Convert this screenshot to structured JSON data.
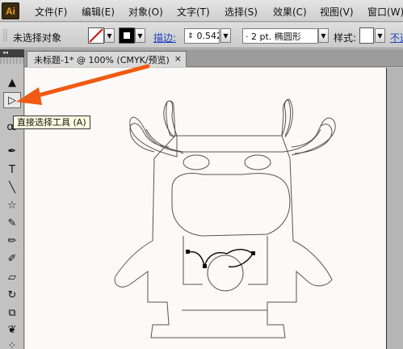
{
  "app": {
    "logo": "Ai"
  },
  "menu": {
    "items": [
      "文件(F)",
      "编辑(E)",
      "对象(O)",
      "文字(T)",
      "选择(S)",
      "效果(C)",
      "视图(V)",
      "窗口(W)"
    ]
  },
  "control_bar": {
    "selection_status": "未选择对象",
    "stroke_label": "描边:",
    "stroke_weight": "0.542",
    "brush": "·  2 pt. 椭圆形",
    "style_label": "样式:",
    "opacity_label": "不透"
  },
  "document_tab": {
    "title": "未标题-1* @ 100% (CMYK/预览)",
    "close": "×"
  },
  "tooltip": {
    "text": "直接选择工具 (A)"
  },
  "tools": [
    {
      "icon": "selection-tool-icon",
      "glyph": "▲"
    },
    {
      "icon": "direct-selection-tool-icon",
      "glyph": "▷",
      "active": true
    },
    {
      "icon": "lasso-tool-icon",
      "glyph": "ꝏ"
    },
    {
      "icon": "pen-tool-icon",
      "glyph": "✒"
    },
    {
      "icon": "type-tool-icon",
      "glyph": "T"
    },
    {
      "icon": "line-tool-icon",
      "glyph": "╲"
    },
    {
      "icon": "star-tool-icon",
      "glyph": "☆"
    },
    {
      "icon": "paintbrush-tool-icon",
      "glyph": "✎"
    },
    {
      "icon": "pencil-tool-icon",
      "glyph": "✏"
    },
    {
      "icon": "blob-brush-tool-icon",
      "glyph": "✐"
    },
    {
      "icon": "eraser-tool-icon",
      "glyph": "▱"
    },
    {
      "icon": "rotate-tool-icon",
      "glyph": "↻"
    },
    {
      "icon": "scale-tool-icon",
      "glyph": "⧉"
    },
    {
      "icon": "warp-tool-icon",
      "glyph": "❦"
    },
    {
      "icon": "symbol-sprayer-tool-icon",
      "glyph": "⁘"
    }
  ],
  "colors": {
    "annotation_arrow": "#f05a12",
    "artboard": "#fdf9f8",
    "ui_gray": "#c9c9c9"
  }
}
